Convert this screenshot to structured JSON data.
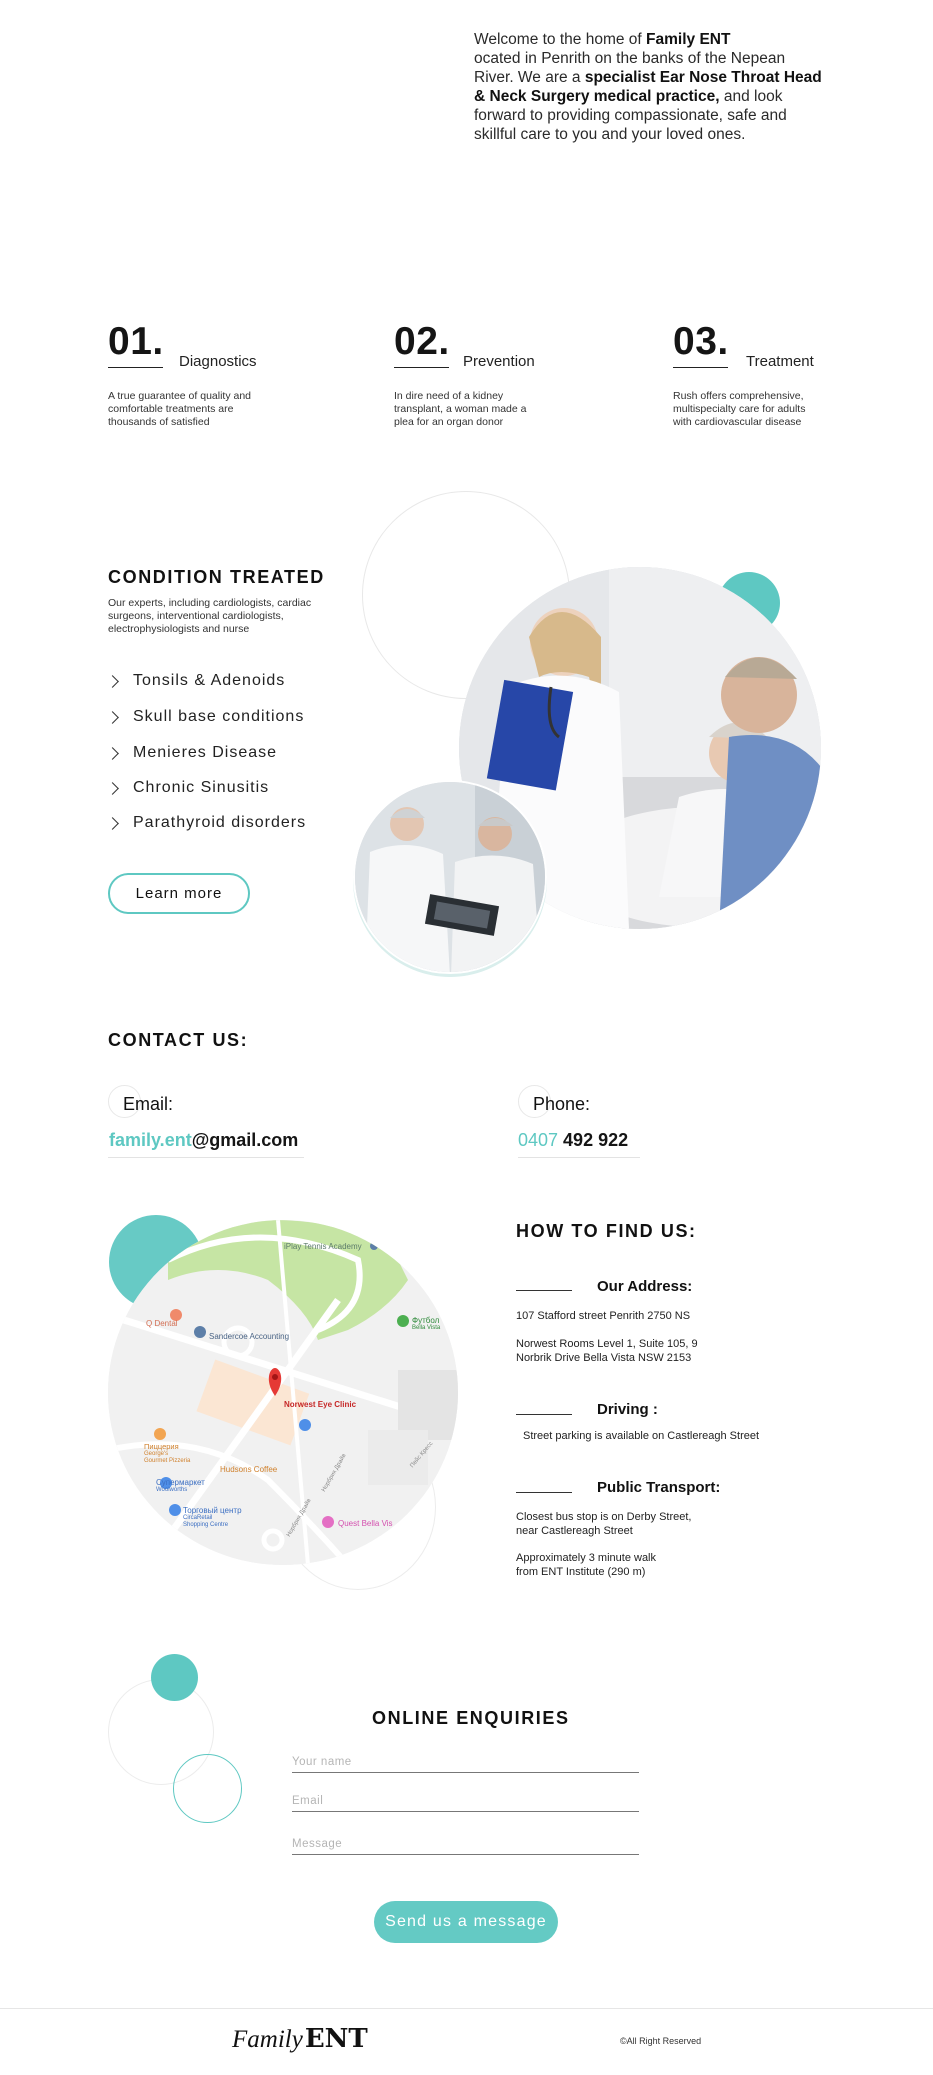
{
  "intro": {
    "t1": "Welcome to the home of ",
    "b1": "Family ENT",
    "t2": "ocated in Penrith on the banks of the Nepean River. We are a ",
    "b2": "specialist Ear Nose Throat Head & Neck Surgery medical practice,",
    "t3": " and look forward to providing compassionate, safe and skillful care to you and your loved ones."
  },
  "steps": [
    {
      "num": "01.",
      "title": "Diagnostics",
      "desc": "A true guarantee of quality and comfortable treatments are thousands of satisfied"
    },
    {
      "num": "02.",
      "title": "Prevention",
      "desc": "In dire need of a kidney transplant, a woman made a plea for an organ donor"
    },
    {
      "num": "03.",
      "title": "Treatment",
      "desc": "Rush offers comprehensive, multispecialty care for adults with cardiovascular disease"
    }
  ],
  "conditions": {
    "heading": "CONDITION TREATED",
    "desc": "Our experts, including cardiologists, cardiac surgeons, interventional cardiologists, electrophysiologists and nurse",
    "items": [
      "Tonsils & Adenoids",
      "Skull base conditions",
      "Menieres Disease",
      "Chronic Sinusitis",
      "Parathyroid disorders"
    ],
    "button": "Learn more"
  },
  "contact": {
    "heading": "CONTACT US:",
    "email_label": "Email:",
    "email_part1": "family.ent",
    "email_part2": "@gmail.com",
    "phone_label": "Phone:",
    "phone_part1": "0407",
    "phone_part2": " 492 922"
  },
  "find": {
    "heading": "HOW TO FIND US:",
    "address_label": "Our Address:",
    "address1": "107 Stafford street Penrith 2750 NS",
    "address2a": "Norwest Rooms Level 1, Suite 105, 9",
    "address2b": "Norbrik Drive Bella Vista NSW 2153",
    "driving_label": "Driving :",
    "driving": "Street parking is available on Castlereagh Street",
    "transport_label": "Public Transport:",
    "transport1a": "Closest bus stop is on Derby Street,",
    "transport1b": "near Castlereagh Street",
    "transport2a": "Approximately 3 minute walk",
    "transport2b": "from ENT Institute (290 m)"
  },
  "map": {
    "labels": {
      "tennis": "iPlay Tennis Academy",
      "dental": "Q Dental",
      "sandercoe": "Sandercoe Accounting",
      "football": "Футбол",
      "football_sub": "Bella Vista",
      "clinic": "Norwest Eye Clinic",
      "pizza": "Пиццерия",
      "pizza_sub1": "George's",
      "pizza_sub2": "Gourmet Pizzeria",
      "hudsons": "Hudsons Coffee",
      "supermarket": "Супермаркет",
      "supermarket_sub": "Woolworths",
      "mall": "Торговый центр",
      "mall_sub1": "CircaRetail",
      "mall_sub2": "Shopping Centre",
      "quest": "Quest Bella Vis",
      "road1": "Норбрик Драйв",
      "road2": "Норбрик Драйв",
      "road3": "Пейс Кресс"
    }
  },
  "enquiries": {
    "heading": "ONLINE ENQUIRIES",
    "name_placeholder": "Your name",
    "email_placeholder": "Email",
    "message_placeholder": "Message",
    "button": "Send us a message"
  },
  "footer": {
    "logo_script": "Family",
    "logo_text": "ENT",
    "copyright": "©All Right Reserved"
  },
  "colors": {
    "accent": "#5ec8c2"
  }
}
